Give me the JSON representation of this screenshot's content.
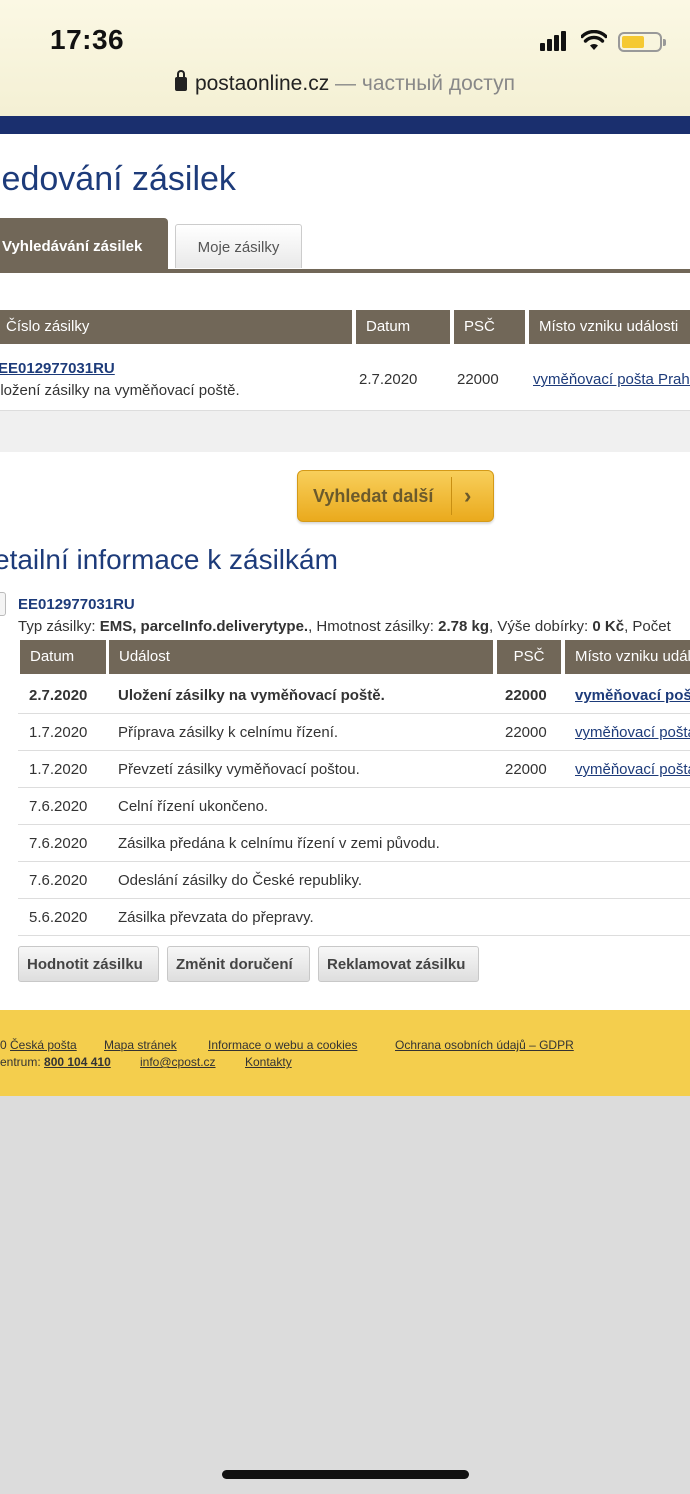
{
  "status": {
    "time": "17:36",
    "url": "postaonline.cz",
    "url_suffix": "— частный доступ"
  },
  "page": {
    "title": "ledování zásilek",
    "tabs": [
      {
        "label": "Vyhledávání zásilek",
        "active": true
      },
      {
        "label": "Moje zásilky",
        "active": false
      }
    ],
    "search_table": {
      "headers": [
        "Číslo zásilky",
        "Datum",
        "PSČ",
        "Místo vzniku události"
      ],
      "row": {
        "number": "EE012977031RU",
        "description": "uložení zásilky na vyměňovací poště.",
        "date": "2.7.2020",
        "psc": "22000",
        "place": "vyměňovací pošta Praha"
      }
    },
    "search_more_button": "Vyhledat další",
    "details_title": "etailní informace k zásilkám",
    "parcel": {
      "id": "EE012977031RU",
      "type_label": "Typ zásilky: ",
      "type_value": "EMS, parcelInfo.deliverytype.",
      "weight_label": ", Hmotnost zásilky: ",
      "weight_value": "2.78 kg",
      "cod_label": ", Výše dobírky: ",
      "cod_value": "0 Kč",
      "count_label": ", Počet"
    },
    "events_table": {
      "headers": [
        "Datum",
        "Událost",
        "PSČ",
        "Místo vzniku události"
      ],
      "rows": [
        {
          "date": "2.7.2020",
          "event": "Uložení zásilky na vyměňovací poště.",
          "psc": "22000",
          "place": "vyměňovací pošta",
          "bold": true
        },
        {
          "date": "1.7.2020",
          "event": "Příprava zásilky k celnímu řízení.",
          "psc": "22000",
          "place": "vyměňovací pošta"
        },
        {
          "date": "1.7.2020",
          "event": "Převzetí zásilky vyměňovací poštou.",
          "psc": "22000",
          "place": "vyměňovací pošta"
        },
        {
          "date": "7.6.2020",
          "event": "Celní řízení ukončeno.",
          "psc": "",
          "place": ""
        },
        {
          "date": "7.6.2020",
          "event": "Zásilka předána k celnímu řízení v zemi původu.",
          "psc": "",
          "place": ""
        },
        {
          "date": "7.6.2020",
          "event": "Odeslání zásilky do České republiky.",
          "psc": "",
          "place": ""
        },
        {
          "date": "5.6.2020",
          "event": "Zásilka převzata do přepravy.",
          "psc": "",
          "place": ""
        }
      ]
    },
    "action_buttons": [
      "Hodnotit zásilku",
      "Změnit doručení",
      "Reklamovat zásilku"
    ]
  },
  "footer": {
    "copyright_prefix": "0 ",
    "ceska_posta": "Česká pošta",
    "sitemap": "Mapa stránek",
    "web_info": "Informace o webu a cookies",
    "privacy": "Ochrana osobních údajů – GDPR",
    "centrum_label": "entrum: ",
    "phone": "800 104 410",
    "email": "info@cpost.cz",
    "contacts": "Kontakty"
  },
  "colors": {
    "brand_blue": "#1d3b7a",
    "header_brown": "#716758",
    "footer_yellow": "#f4ce4d",
    "button_gold": "#f0b83a"
  }
}
